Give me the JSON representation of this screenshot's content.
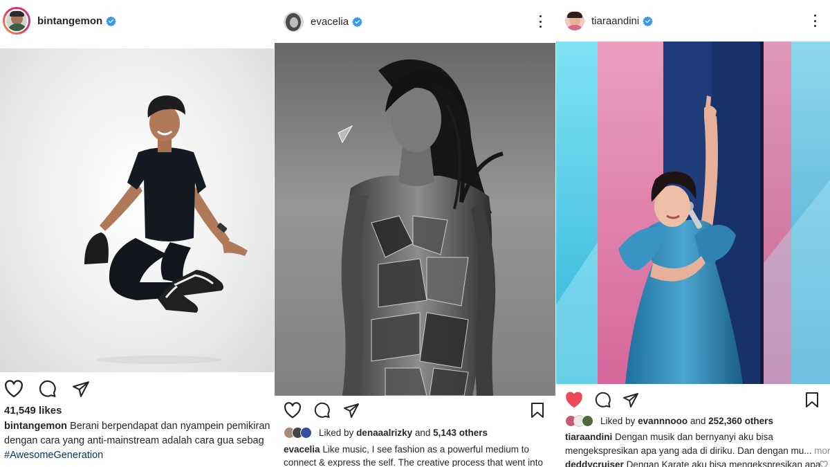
{
  "posts": [
    {
      "username": "bintangemon",
      "likes": "41,549 likes",
      "caption_user": "bintangemon",
      "caption_lines": [
        "Berani berpendapat dan nyampein pemikiran",
        "dengan cara yang anti-mainstream adalah cara gua sebag"
      ],
      "hashtag": "#AwesomeGeneration",
      "liked": false
    },
    {
      "username": "evacelia",
      "liked_by_prefix": "Liked by",
      "liked_by_user": "denaaalrizky",
      "liked_by_and": "and",
      "liked_by_others": "5,143 others",
      "caption_user": "evacelia",
      "caption_lines": [
        "Like music, I see fashion as a powerful medium to",
        "connect & express the self. The creative process that went into"
      ],
      "liked": false
    },
    {
      "username": "tiaraandini",
      "liked_by_prefix": "Liked by",
      "liked_by_user": "evannnooo",
      "liked_by_and": "and",
      "liked_by_others": "252,360 others",
      "caption_user": "tiaraandini",
      "caption_lines": [
        "Dengan musik dan bernyanyi aku bisa",
        "mengekspresikan apa yang ada di diriku. Dan dengan mu..."
      ],
      "more_label": "more",
      "comment_user": "deddycruiser",
      "comment_text": "Dengan Karate aku bisa mengekspresikan apa",
      "liked": true
    }
  ],
  "icons": {
    "like": "heart-icon",
    "liked": "heart-filled-icon",
    "comment": "comment-icon",
    "share": "paper-plane-icon",
    "save": "bookmark-icon",
    "verified": "verified-badge-icon",
    "more": "more-options-icon"
  },
  "colors": {
    "verified_blue": "#3897f0",
    "like_red": "#ed4956",
    "text": "#262626",
    "link": "#00376b",
    "muted": "#8e8e8e"
  }
}
